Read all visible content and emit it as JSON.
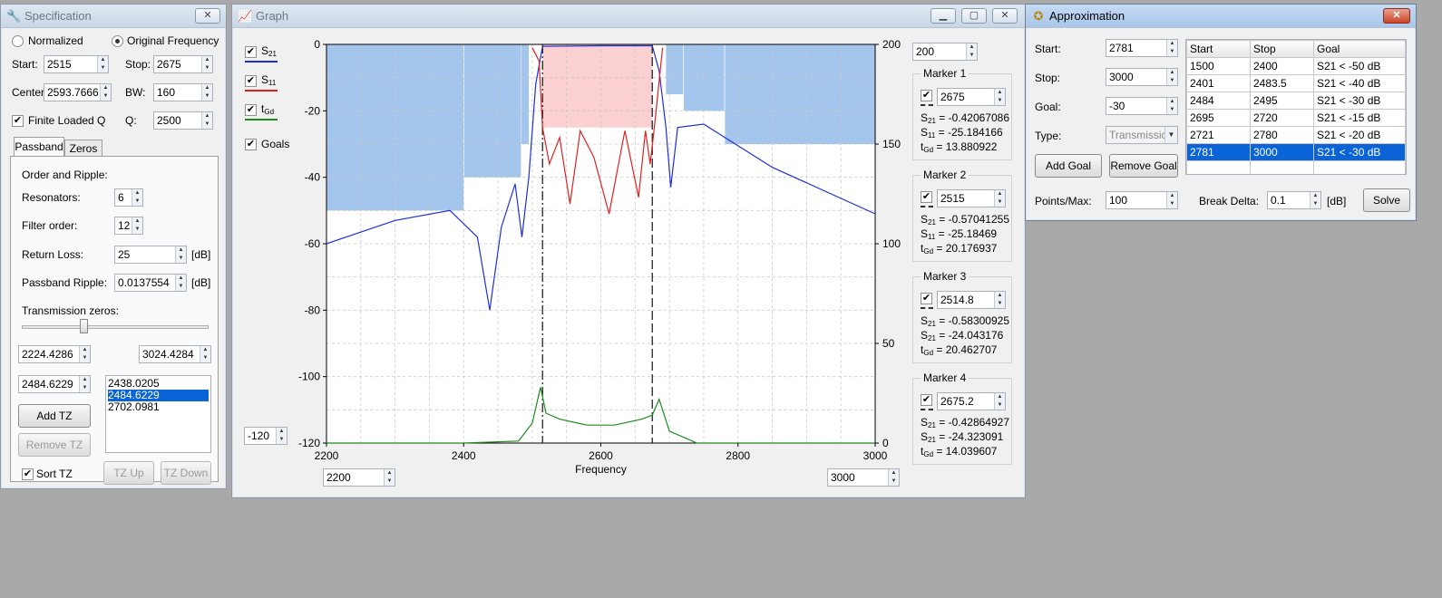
{
  "spec": {
    "title": "Specification",
    "radio_normalized": "Normalized",
    "radio_original": "Original Frequency",
    "start_label": "Start:",
    "start_value": "2515",
    "stop_label": "Stop:",
    "stop_value": "2675",
    "center_label": "Center:",
    "center_value": "2593.7666",
    "bw_label": "BW:",
    "bw_value": "160",
    "finite_q_label": "Finite Loaded Q",
    "q_label": "Q:",
    "q_value": "2500",
    "tab_passband": "Passband",
    "tab_zeros": "Zeros",
    "order_ripple": "Order and Ripple:",
    "resonators_label": "Resonators:",
    "resonators_value": "6",
    "order_label": "Filter order:",
    "order_value": "12",
    "return_loss_label": "Return Loss:",
    "return_loss_value": "25",
    "db1": "[dB]",
    "ripple_label": "Passband Ripple:",
    "ripple_value": "0.0137554",
    "db2": "[dB]",
    "tz_label": "Transmission zeros:",
    "tz_min": "2224.4286",
    "tz_max": "3024.4284",
    "tz_current": "2484.6229",
    "tz_list": [
      "2438.0205",
      "2484.6229",
      "2702.0981"
    ],
    "add_tz": "Add TZ",
    "remove_tz": "Remove TZ",
    "sort_tz": "Sort TZ",
    "tz_up": "TZ Up",
    "tz_down": "TZ Down"
  },
  "graph": {
    "title": "Graph",
    "legend": {
      "s21": "S",
      "s21_sub": "21",
      "s11": "S",
      "s11_sub": "11",
      "tgd": "t",
      "tgd_sub": "Gd",
      "goals": "Goals"
    },
    "ymin_box": "-120",
    "ymax_right_box": "200",
    "xmin_box": "2200",
    "xmax_box": "3000",
    "xlabel": "Frequency",
    "left_ticks": [
      "0",
      "-20",
      "-40",
      "-60",
      "-80",
      "-100",
      "-120"
    ],
    "right_ticks": [
      "200",
      "150",
      "100",
      "50",
      "0"
    ],
    "x_ticks": [
      "2200",
      "2400",
      "2600",
      "2800",
      "3000"
    ],
    "markers": [
      {
        "title": "Marker 1",
        "value": "2675",
        "l1": "S",
        "l1s": "21",
        "v1": " = -0.42067086",
        "l2": "S",
        "l2s": "11",
        "v2": " = -25.184166",
        "l3": "t",
        "l3s": "Gd",
        "v3": " = 13.880922"
      },
      {
        "title": "Marker 2",
        "value": "2515",
        "l1": "S",
        "l1s": "21",
        "v1": " = -0.57041255",
        "l2": "S",
        "l2s": "11",
        "v2": " = -25.18469",
        "l3": "t",
        "l3s": "Gd",
        "v3": " = 20.176937"
      },
      {
        "title": "Marker 3",
        "value": "2514.8",
        "l1": "S",
        "l1s": "21",
        "v1": " = -0.58300925",
        "l2": "S",
        "l2s": "21",
        "v2": " = -24.043176",
        "l3": "t",
        "l3s": "Gd",
        "v3": " = 20.462707"
      },
      {
        "title": "Marker 4",
        "value": "2675.2",
        "l1": "S",
        "l1s": "21",
        "v1": " = -0.42864927",
        "l2": "S",
        "l2s": "21",
        "v2": " = -24.323091",
        "l3": "t",
        "l3s": "Gd",
        "v3": " = 14.039607"
      }
    ]
  },
  "approx": {
    "title": "Approximation",
    "start_label": "Start:",
    "start_value": "2781",
    "stop_label": "Stop:",
    "stop_value": "3000",
    "goal_label": "Goal:",
    "goal_value": "-30",
    "type_label": "Type:",
    "type_value": "Transmissio",
    "add_goal": "Add Goal",
    "remove_goal": "Remove Goal",
    "points_label": "Points/Max:",
    "points_value": "100",
    "break_label": "Break Delta:",
    "break_value": "0.1",
    "break_unit": "[dB]",
    "solve": "Solve",
    "columns": [
      "Start",
      "Stop",
      "Goal"
    ],
    "rows": [
      [
        "1500",
        "2400",
        "S21 < -50 dB"
      ],
      [
        "2401",
        "2483.5",
        "S21 < -40 dB"
      ],
      [
        "2484",
        "2495",
        "S21 < -30 dB"
      ],
      [
        "2695",
        "2720",
        "S21 < -15 dB"
      ],
      [
        "2721",
        "2780",
        "S21 < -20 dB"
      ],
      [
        "2781",
        "3000",
        "S21 < -30 dB"
      ]
    ]
  },
  "chart_data": {
    "type": "line",
    "xlabel": "Frequency",
    "xlim": [
      2200,
      3000
    ],
    "ylim_left": [
      -120,
      0
    ],
    "ylim_right": [
      0,
      200
    ],
    "grid": true,
    "goal_regions": [
      {
        "x": [
          2200,
          2400
        ],
        "y_top": -50
      },
      {
        "x": [
          2401,
          2483.5
        ],
        "y_top": -40
      },
      {
        "x": [
          2484,
          2495
        ],
        "y_top": -30
      },
      {
        "x": [
          2695,
          2720
        ],
        "y_top": -15
      },
      {
        "x": [
          2721,
          2780
        ],
        "y_top": -20
      },
      {
        "x": [
          2781,
          3000
        ],
        "y_top": -30
      }
    ],
    "passband_region": {
      "x": [
        2515,
        2675
      ],
      "y": [
        -25,
        0
      ]
    },
    "marker_lines_x": [
      2515,
      2675
    ],
    "series": [
      {
        "name": "S21",
        "color": "#1f2fd6",
        "axis": "left",
        "x": [
          2200,
          2300,
          2380,
          2420,
          2438,
          2455,
          2475,
          2485,
          2495,
          2505,
          2515,
          2600,
          2675,
          2685,
          2695,
          2702,
          2712,
          2750,
          2850,
          3000
        ],
        "y": [
          -60,
          -53,
          -50,
          -58,
          -80,
          -55,
          -42,
          -58,
          -40,
          -12,
          -0.6,
          -0.4,
          -0.4,
          -8,
          -25,
          -43,
          -25,
          -24,
          -37,
          -51
        ]
      },
      {
        "name": "S11",
        "color": "#e02020",
        "axis": "left",
        "x": [
          2500,
          2510,
          2515,
          2525,
          2540,
          2555,
          2570,
          2590,
          2612,
          2635,
          2655,
          2665,
          2672,
          2678,
          2690
        ],
        "y": [
          -1,
          -5,
          -25,
          -36,
          -28,
          -48,
          -26,
          -34,
          -51,
          -26,
          -46,
          -26,
          -36,
          -25,
          -1
        ]
      },
      {
        "name": "tGd",
        "color": "#1d8a1d",
        "axis": "right",
        "x": [
          2200,
          2400,
          2480,
          2500,
          2512,
          2520,
          2540,
          2580,
          2620,
          2660,
          2675,
          2685,
          2700,
          2740,
          3000
        ],
        "y": [
          0,
          0,
          1,
          10,
          28,
          15,
          12,
          9,
          9,
          12,
          14,
          22,
          6,
          0,
          0
        ]
      }
    ]
  }
}
